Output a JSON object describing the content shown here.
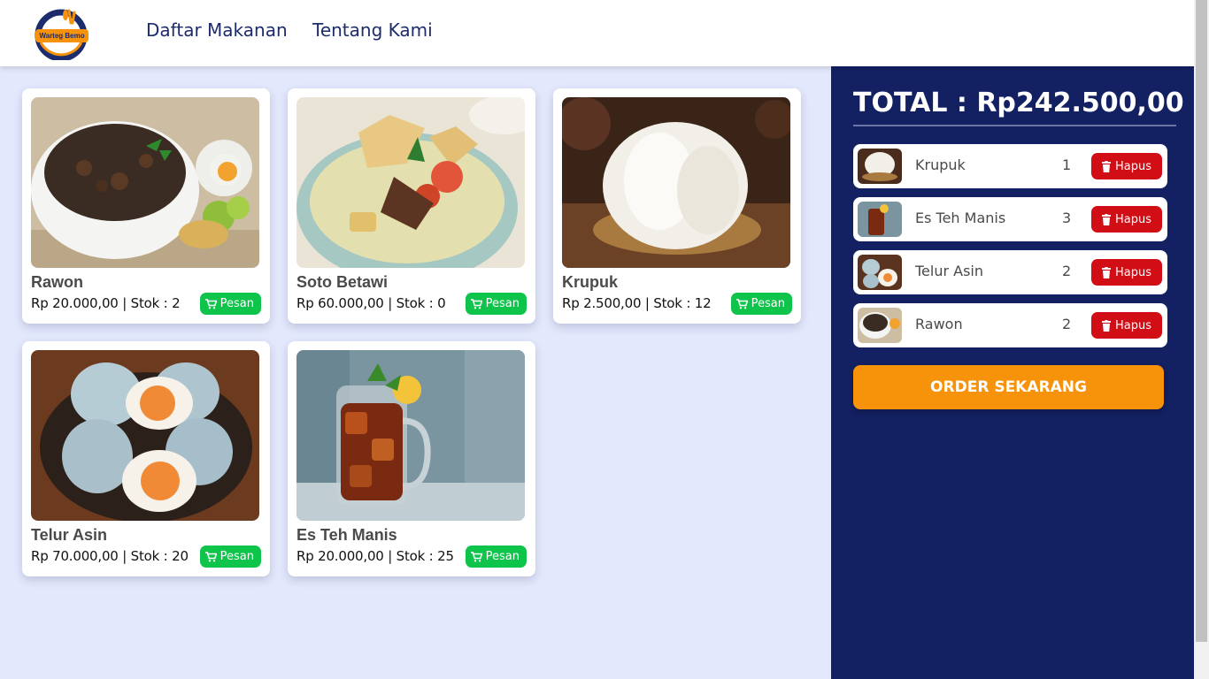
{
  "brand": {
    "logo_text": "Warteg Bemo"
  },
  "nav": {
    "items": [
      "Daftar Makanan",
      "Tentang Kami"
    ]
  },
  "products": [
    {
      "name": "Rawon",
      "price_stock": "Rp 20.000,00 | Stok : 2",
      "button": "Pesan"
    },
    {
      "name": "Soto Betawi",
      "price_stock": "Rp 60.000,00 | Stok : 0",
      "button": "Pesan"
    },
    {
      "name": "Krupuk",
      "price_stock": "Rp 2.500,00 | Stok : 12",
      "button": "Pesan"
    },
    {
      "name": "Telur Asin",
      "price_stock": "Rp 70.000,00 | Stok : 20",
      "button": "Pesan"
    },
    {
      "name": "Es Teh Manis",
      "price_stock": "Rp 20.000,00 | Stok : 25",
      "button": "Pesan"
    }
  ],
  "cart": {
    "total": "TOTAL : Rp242.500,00",
    "items": [
      {
        "name": "Krupuk",
        "qty": "1",
        "button": "Hapus"
      },
      {
        "name": "Es Teh Manis",
        "qty": "3",
        "button": "Hapus"
      },
      {
        "name": "Telur Asin",
        "qty": "2",
        "button": "Hapus"
      },
      {
        "name": "Rawon",
        "qty": "2",
        "button": "Hapus"
      }
    ],
    "order_button": "ORDER SEKARANG"
  },
  "colors": {
    "nav_text": "#1c2c6c",
    "page_bg": "#e3e8fc",
    "sidebar_bg": "#132062",
    "pesan_button": "#0fc44b",
    "hapus_button": "#d10d15",
    "order_button": "#f7920b"
  },
  "icons": {
    "pesan": "cart-icon",
    "hapus": "trash-icon"
  }
}
